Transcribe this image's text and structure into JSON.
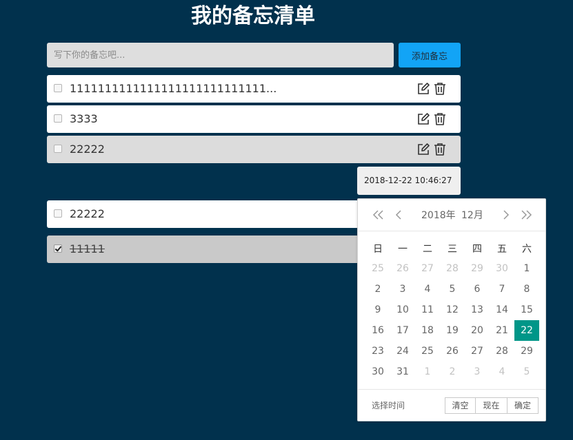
{
  "title": "我的备忘清单",
  "input": {
    "placeholder": "写下你的备忘吧...",
    "add_label": "添加备忘"
  },
  "memos": [
    {
      "text": "1111111111111111111111111111...",
      "checked": false,
      "style": "white"
    },
    {
      "text": "3333",
      "checked": false,
      "style": "white"
    },
    {
      "text": "22222",
      "checked": false,
      "style": "gray"
    },
    {
      "text": "22222",
      "checked": false,
      "style": "white"
    },
    {
      "text": "11111",
      "checked": true,
      "style": "done"
    }
  ],
  "datetime": "2018-12-22 10:46:27",
  "picker": {
    "year": "2018年",
    "month": "12月",
    "weekdays": [
      "日",
      "一",
      "二",
      "三",
      "四",
      "五",
      "六"
    ],
    "days": [
      [
        "25",
        0
      ],
      [
        "26",
        0
      ],
      [
        "27",
        0
      ],
      [
        "28",
        0
      ],
      [
        "29",
        0
      ],
      [
        "30",
        0
      ],
      [
        "1",
        1
      ],
      [
        "2",
        1
      ],
      [
        "3",
        1
      ],
      [
        "4",
        1
      ],
      [
        "5",
        1
      ],
      [
        "6",
        1
      ],
      [
        "7",
        1
      ],
      [
        "8",
        1
      ],
      [
        "9",
        1
      ],
      [
        "10",
        1
      ],
      [
        "11",
        1
      ],
      [
        "12",
        1
      ],
      [
        "13",
        1
      ],
      [
        "14",
        1
      ],
      [
        "15",
        1
      ],
      [
        "16",
        1
      ],
      [
        "17",
        1
      ],
      [
        "18",
        1
      ],
      [
        "19",
        1
      ],
      [
        "20",
        1
      ],
      [
        "21",
        1
      ],
      [
        "22",
        2
      ],
      [
        "23",
        1
      ],
      [
        "24",
        1
      ],
      [
        "25",
        1
      ],
      [
        "26",
        1
      ],
      [
        "27",
        1
      ],
      [
        "28",
        1
      ],
      [
        "29",
        1
      ],
      [
        "30",
        1
      ],
      [
        "31",
        1
      ],
      [
        "1",
        0
      ],
      [
        "2",
        0
      ],
      [
        "3",
        0
      ],
      [
        "4",
        0
      ],
      [
        "5",
        0
      ]
    ],
    "select_time_label": "选择时间",
    "clear_label": "清空",
    "now_label": "现在",
    "confirm_label": "确定"
  },
  "colors": {
    "background": "#01314d",
    "accent": "#12a4f6",
    "selected_day": "#009688"
  }
}
